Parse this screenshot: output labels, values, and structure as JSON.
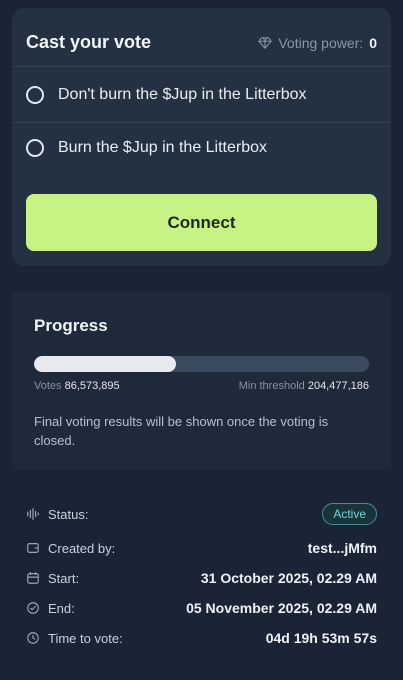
{
  "vote": {
    "title": "Cast your vote",
    "voting_power_label": "Voting power:",
    "voting_power_value": "0",
    "options": [
      {
        "label": "Don't burn the $Jup in the Litterbox"
      },
      {
        "label": "Burn the $Jup in the Litterbox"
      }
    ],
    "connect_label": "Connect"
  },
  "progress": {
    "title": "Progress",
    "votes_label": "Votes",
    "votes_value": "86,573,895",
    "threshold_label": "Min threshold",
    "threshold_value": "204,477,186",
    "fill_fraction": 0.423,
    "note": "Final voting results will be shown once the voting is closed."
  },
  "details": {
    "status_label": "Status:",
    "status_value": "Active",
    "created_label": "Created by:",
    "created_value": "test...jMfm",
    "start_label": "Start:",
    "start_value": "31 October 2025, 02.29 AM",
    "end_label": "End:",
    "end_value": "05 November 2025, 02.29 AM",
    "time_label": "Time to vote:",
    "time_value": "04d 19h 53m 57s"
  },
  "colors": {
    "accent": "#c7f284",
    "background": "#1a2434",
    "status_active": "#6fd6dd"
  }
}
